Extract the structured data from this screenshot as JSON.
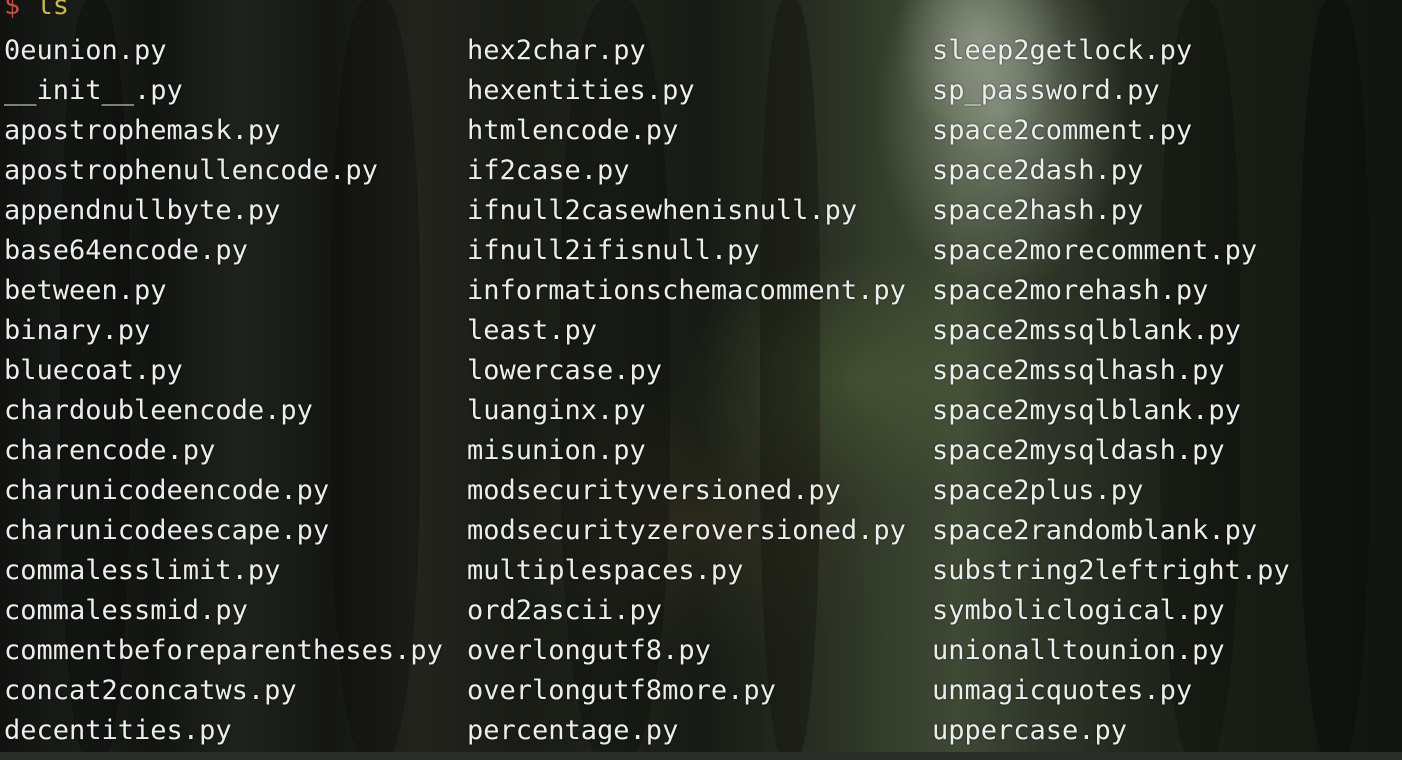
{
  "prompt": {
    "symbol": "$",
    "command": "ls"
  },
  "colors": {
    "prompt_symbol": "#c4504a",
    "prompt_command": "#c8b64e",
    "text": "#ededed"
  },
  "columns": [
    [
      "0eunion.py",
      "__init__.py",
      "apostrophemask.py",
      "apostrophenullencode.py",
      "appendnullbyte.py",
      "base64encode.py",
      "between.py",
      "binary.py",
      "bluecoat.py",
      "chardoubleencode.py",
      "charencode.py",
      "charunicodeencode.py",
      "charunicodeescape.py",
      "commalesslimit.py",
      "commalessmid.py",
      "commentbeforeparentheses.py",
      "concat2concatws.py",
      "decentities.py"
    ],
    [
      "hex2char.py",
      "hexentities.py",
      "htmlencode.py",
      "if2case.py",
      "ifnull2casewhenisnull.py",
      "ifnull2ifisnull.py",
      "informationschemacomment.py",
      "least.py",
      "lowercase.py",
      "luanginx.py",
      "misunion.py",
      "modsecurityversioned.py",
      "modsecurityzeroversioned.py",
      "multiplespaces.py",
      "ord2ascii.py",
      "overlongutf8.py",
      "overlongutf8more.py",
      "percentage.py"
    ],
    [
      "sleep2getlock.py",
      "sp_password.py",
      "space2comment.py",
      "space2dash.py",
      "space2hash.py",
      "space2morecomment.py",
      "space2morehash.py",
      "space2mssqlblank.py",
      "space2mssqlhash.py",
      "space2mysqlblank.py",
      "space2mysqldash.py",
      "space2plus.py",
      "space2randomblank.py",
      "substring2leftright.py",
      "symboliclogical.py",
      "unionalltounion.py",
      "unmagicquotes.py",
      "uppercase.py"
    ]
  ]
}
